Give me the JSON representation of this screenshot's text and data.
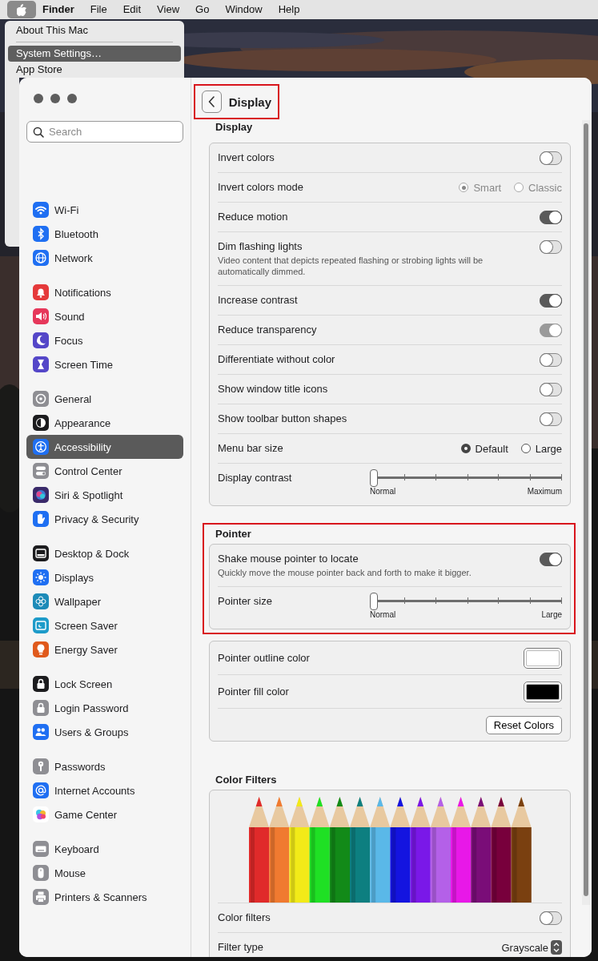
{
  "menu_bar": {
    "apple_menu_open": true,
    "items": [
      {
        "label": "Finder",
        "kind": "app"
      },
      {
        "label": "File",
        "kind": "menu"
      },
      {
        "label": "Edit",
        "kind": "menu"
      },
      {
        "label": "View",
        "kind": "menu"
      },
      {
        "label": "Go",
        "kind": "menu"
      },
      {
        "label": "Window",
        "kind": "menu"
      },
      {
        "label": "Help",
        "kind": "menu"
      }
    ]
  },
  "apple_menu": {
    "items": [
      {
        "kind": "item",
        "label": "About This Mac",
        "selected": false
      },
      {
        "kind": "separator"
      },
      {
        "kind": "item",
        "label": "System Settings…",
        "selected": true
      },
      {
        "kind": "item",
        "label": "App Store",
        "selected": false
      }
    ]
  },
  "sidebar": {
    "search": {
      "placeholder": "Search"
    },
    "groups": [
      [
        {
          "label": "Wi-Fi",
          "kind": "wifi",
          "color": "#1f6ff2",
          "selected": false
        },
        {
          "label": "Bluetooth",
          "kind": "bluetooth",
          "color": "#1f6ff2",
          "selected": false
        },
        {
          "label": "Network",
          "kind": "globe",
          "color": "#1f6ff2",
          "selected": false
        }
      ],
      [
        {
          "label": "Notifications",
          "kind": "bell",
          "color": "#e5393a",
          "selected": false
        },
        {
          "label": "Sound",
          "kind": "speaker",
          "color": "#e6375a",
          "selected": false
        },
        {
          "label": "Focus",
          "kind": "moon",
          "color": "#5547c8",
          "selected": false
        },
        {
          "label": "Screen Time",
          "kind": "hourglass",
          "color": "#5547c8",
          "selected": false
        }
      ],
      [
        {
          "label": "General",
          "kind": "gear",
          "color": "#8e8e93",
          "selected": false
        },
        {
          "label": "Appearance",
          "kind": "contrast",
          "color": "#1c1c1e",
          "selected": false
        },
        {
          "label": "Accessibility",
          "kind": "person",
          "color": "#1f6ff2",
          "selected": true
        },
        {
          "label": "Control Center",
          "kind": "switches",
          "color": "#8e8e93",
          "selected": false
        },
        {
          "label": "Siri & Spotlight",
          "kind": "orb",
          "color": "#3a2a6a",
          "selected": false
        },
        {
          "label": "Privacy & Security",
          "kind": "hand",
          "color": "#1f6ff2",
          "selected": false
        }
      ],
      [
        {
          "label": "Desktop & Dock",
          "kind": "dock",
          "color": "#1c1c1e",
          "selected": false
        },
        {
          "label": "Displays",
          "kind": "sun",
          "color": "#1f6ff2",
          "selected": false
        },
        {
          "label": "Wallpaper",
          "kind": "flower",
          "color": "#1d8bb8",
          "selected": false
        },
        {
          "label": "Screen Saver",
          "kind": "screen",
          "color": "#1d9bc9",
          "selected": false
        },
        {
          "label": "Energy Saver",
          "kind": "bulb",
          "color": "#e05a1c",
          "selected": false
        }
      ],
      [
        {
          "label": "Lock Screen",
          "kind": "lock",
          "color": "#1c1c1e",
          "selected": false
        },
        {
          "label": "Login Password",
          "kind": "lock",
          "color": "#8e8e93",
          "selected": false
        },
        {
          "label": "Users & Groups",
          "kind": "people",
          "color": "#1f6ff2",
          "selected": false
        }
      ],
      [
        {
          "label": "Passwords",
          "kind": "key",
          "color": "#8e8e93",
          "selected": false
        },
        {
          "label": "Internet Accounts",
          "kind": "at",
          "color": "#1f6ff2",
          "selected": false
        },
        {
          "label": "Game Center",
          "kind": "bubbles",
          "color": "#ffffff",
          "selected": false
        }
      ],
      [
        {
          "label": "Keyboard",
          "kind": "keyboard",
          "color": "#8e8e93",
          "selected": false
        },
        {
          "label": "Mouse",
          "kind": "mouse",
          "color": "#8e8e93",
          "selected": false
        },
        {
          "label": "Printers & Scanners",
          "kind": "printer",
          "color": "#8e8e93",
          "selected": false
        }
      ]
    ]
  },
  "detail": {
    "title": "Display",
    "title_highlighted": true,
    "sections": [
      {
        "heading": "Display",
        "highlighted": false,
        "rows": [
          {
            "kind": "toggle",
            "label": "Invert colors",
            "on": false,
            "disabled": false
          },
          {
            "kind": "radio",
            "label": "Invert colors mode",
            "disabled": true,
            "options": [
              {
                "label": "Smart",
                "selected": true
              },
              {
                "label": "Classic",
                "selected": false
              }
            ]
          },
          {
            "kind": "toggle",
            "label": "Reduce motion",
            "on": true,
            "disabled": false
          },
          {
            "kind": "toggle",
            "label": "Dim flashing lights",
            "subtitle": "Video content that depicts repeated flashing or strobing lights will be automatically dimmed.",
            "on": false,
            "disabled": false
          },
          {
            "kind": "toggle",
            "label": "Increase contrast",
            "on": true,
            "disabled": false
          },
          {
            "kind": "toggle",
            "label": "Reduce transparency",
            "on": true,
            "disabled": true
          },
          {
            "kind": "toggle",
            "label": "Differentiate without color",
            "on": false,
            "disabled": false
          },
          {
            "kind": "toggle",
            "label": "Show window title icons",
            "on": false,
            "disabled": false
          },
          {
            "kind": "toggle",
            "label": "Show toolbar button shapes",
            "on": false,
            "disabled": false
          },
          {
            "kind": "radio",
            "label": "Menu bar size",
            "disabled": false,
            "options": [
              {
                "label": "Default",
                "selected": true
              },
              {
                "label": "Large",
                "selected": false
              }
            ]
          },
          {
            "kind": "slider",
            "label": "Display contrast",
            "level": 0,
            "min_label": "Normal",
            "max_label": "Maximum"
          }
        ]
      },
      {
        "heading": "Pointer",
        "highlighted": true,
        "rows": [
          {
            "kind": "toggle",
            "label": "Shake mouse pointer to locate",
            "subtitle": "Quickly move the mouse pointer back and forth to make it bigger.",
            "on": true,
            "disabled": false
          },
          {
            "kind": "slider",
            "label": "Pointer size",
            "level": 0,
            "min_label": "Normal",
            "max_label": "Large"
          }
        ]
      },
      {
        "highlighted": false,
        "rows": [
          {
            "kind": "swatch",
            "label": "Pointer outline color",
            "color": "#ffffff"
          },
          {
            "kind": "swatch",
            "label": "Pointer fill color",
            "color": "#000000"
          },
          {
            "kind": "button",
            "label": "Reset Colors"
          }
        ]
      },
      {
        "heading": "Color Filters",
        "highlighted": false,
        "rows": [
          {
            "kind": "pencils"
          },
          {
            "kind": "toggle",
            "label": "Color filters",
            "on": false,
            "disabled": false
          },
          {
            "kind": "popup",
            "label": "Filter type",
            "value": "Grayscale"
          }
        ]
      }
    ]
  }
}
